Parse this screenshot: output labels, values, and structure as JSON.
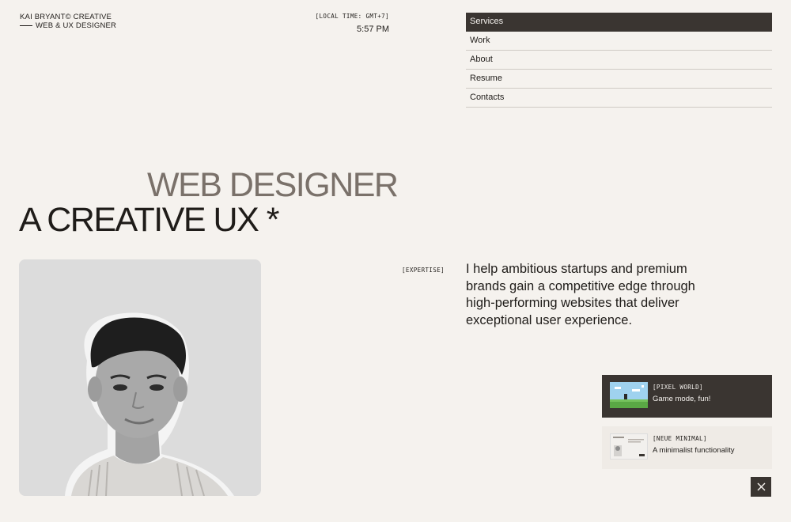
{
  "brand": {
    "name": "KAI BRYANT© CREATIVE",
    "role": "WEB & UX DESIGNER"
  },
  "clock": {
    "label": "[LOCAL TIME: GMT+7]",
    "value": "5:57 PM"
  },
  "nav": {
    "items": [
      {
        "label": "Services",
        "active": true
      },
      {
        "label": "Work"
      },
      {
        "label": "About"
      },
      {
        "label": "Resume"
      },
      {
        "label": "Contacts"
      }
    ]
  },
  "hero": {
    "line1": "WEB DESIGNER",
    "line2": "A CREATIVE UX *"
  },
  "expertise": {
    "tag": "[EXPERTISE]",
    "text": "I help ambitious startups and premium brands gain a competitive edge through high-performing websites that deliver exceptional user experience."
  },
  "cards": [
    {
      "tag": "[PIXEL WORLD]",
      "desc": "Game mode, fun!"
    },
    {
      "tag": "[NEUE MINIMAL]",
      "desc": "A minimalist functionality"
    }
  ],
  "colors": {
    "background": "#f5f2ee",
    "dark": "#3a3531",
    "muted_heading": "#7a716a"
  },
  "icons": {
    "close": "close-icon"
  }
}
